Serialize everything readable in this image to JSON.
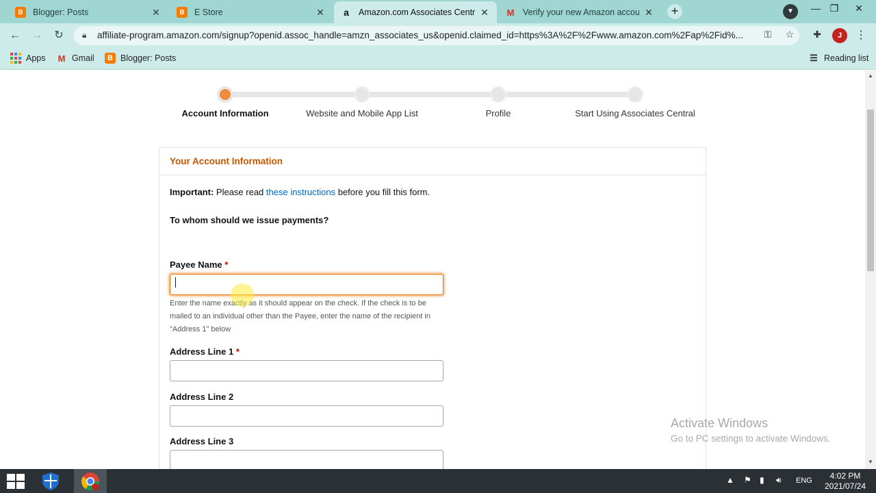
{
  "browser": {
    "tabs": [
      {
        "title": "Blogger: Posts",
        "icon": "blogger-icon"
      },
      {
        "title": "E Store",
        "icon": "blogger-icon"
      },
      {
        "title": "Amazon.com Associates Central",
        "icon": "amazon-icon",
        "active": true
      },
      {
        "title": "Verify your new Amazon account",
        "icon": "gmail-icon"
      }
    ],
    "url": "affiliate-program.amazon.com/signup?openid.assoc_handle=amzn_associates_us&openid.claimed_id=https%3A%2F%2Fwww.amazon.com%2Fap%2Fid%...",
    "profile_initial": "J",
    "bookmarks": [
      {
        "label": "Apps"
      },
      {
        "label": "Gmail"
      },
      {
        "label": "Blogger: Posts"
      }
    ],
    "reading_list": "Reading list"
  },
  "steps": [
    {
      "label": "Account Information",
      "active": true
    },
    {
      "label": "Website and Mobile App List",
      "active": false
    },
    {
      "label": "Profile",
      "active": false
    },
    {
      "label": "Start Using Associates Central",
      "active": false
    }
  ],
  "form": {
    "section_title": "Your Account Information",
    "important_label": "Important:",
    "important_pre": "Please read",
    "important_link": "these instructions",
    "important_post": "before you fill this form.",
    "question": "To whom should we issue payments?",
    "payee_label": "Payee Name",
    "required_mark": "*",
    "payee_value": "",
    "payee_help": "Enter the name exactly as it should appear on the check. If the check is to be mailed to an individual other than the Payee, enter the name of the recipient in \"Address 1\" below",
    "address1_label": "Address Line 1",
    "address2_label": "Address Line 2",
    "address3_label": "Address Line 3"
  },
  "watermark": {
    "line1": "Activate Windows",
    "line2": "Go to PC settings to activate Windows."
  },
  "taskbar": {
    "language": "ENG",
    "time": "4:02 PM",
    "date": "2021/07/24"
  },
  "colors": {
    "accent_orange": "#f08a3c",
    "section_title": "#c45500",
    "link": "#0066c0",
    "chrome_teal": "#cdebe8"
  }
}
